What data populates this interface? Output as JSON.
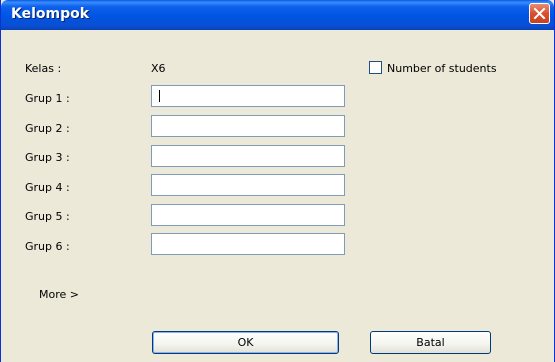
{
  "window": {
    "title": "Kelompok"
  },
  "kelas": {
    "label": "Kelas :",
    "value": "X6"
  },
  "checkbox": {
    "label": "Number of students",
    "checked": false
  },
  "groups": [
    {
      "label": "Grup 1 :",
      "value": ""
    },
    {
      "label": "Grup 2 :",
      "value": ""
    },
    {
      "label": "Grup 3 :",
      "value": ""
    },
    {
      "label": "Grup 4 :",
      "value": ""
    },
    {
      "label": "Grup 5 :",
      "value": ""
    },
    {
      "label": "Grup 6 :",
      "value": ""
    }
  ],
  "more_link": "More >",
  "buttons": {
    "ok": "OK",
    "cancel": "Batal"
  },
  "icons": {
    "close": "close-icon"
  },
  "colors": {
    "titlebar": "#0054e3",
    "close": "#d8502f",
    "face": "#ece9d8",
    "input_border": "#7f9db9"
  }
}
